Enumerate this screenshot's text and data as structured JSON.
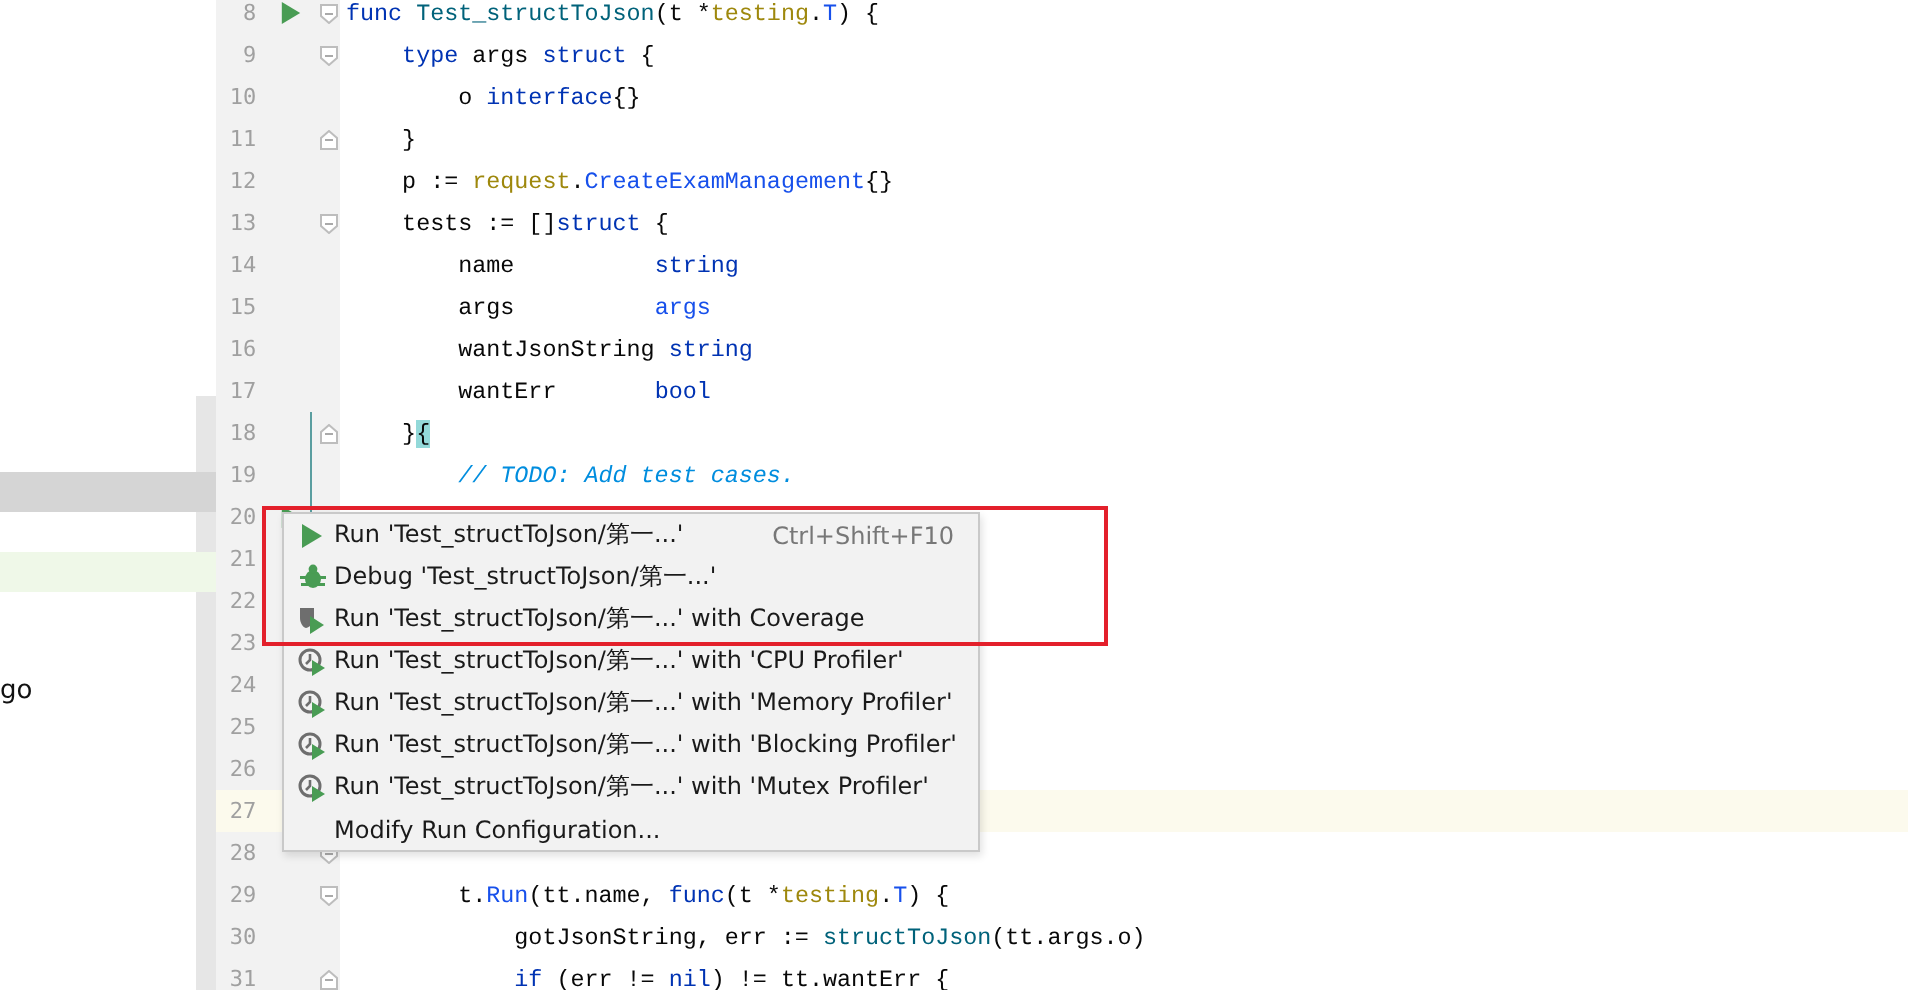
{
  "side_panel": {
    "rows": [
      {
        "selected": true,
        "changed": false
      },
      {
        "selected": false,
        "changed": true
      }
    ],
    "text": "go"
  },
  "editor": {
    "lines": [
      {
        "number": "8",
        "run": true,
        "fold_start": true,
        "tokens": [
          {
            "kind": "kw",
            "text": "func "
          },
          {
            "kind": "fn",
            "text": "Test_structToJson"
          },
          {
            "kind": "plain",
            "text": "(t *"
          },
          {
            "kind": "pkg",
            "text": "testing"
          },
          {
            "kind": "plain",
            "text": "."
          },
          {
            "kind": "type",
            "text": "T"
          },
          {
            "kind": "plain",
            "text": ") {"
          }
        ]
      },
      {
        "number": "9",
        "fold_start": true,
        "tokens": [
          {
            "kind": "kw",
            "text": "    type "
          },
          {
            "kind": "plain",
            "text": "args "
          },
          {
            "kind": "kw",
            "text": "struct"
          },
          {
            "kind": "plain",
            "text": " {"
          }
        ]
      },
      {
        "number": "10",
        "tokens": [
          {
            "kind": "plain",
            "text": "        o "
          },
          {
            "kind": "kw",
            "text": "interface"
          },
          {
            "kind": "plain",
            "text": "{}"
          }
        ]
      },
      {
        "number": "11",
        "fold_end": true,
        "tokens": [
          {
            "kind": "plain",
            "text": "    }"
          }
        ]
      },
      {
        "number": "12",
        "tokens": [
          {
            "kind": "plain",
            "text": "    p := "
          },
          {
            "kind": "pkg",
            "text": "request"
          },
          {
            "kind": "plain",
            "text": "."
          },
          {
            "kind": "type",
            "text": "CreateExamManagement"
          },
          {
            "kind": "plain",
            "text": "{}"
          }
        ]
      },
      {
        "number": "13",
        "fold_start": true,
        "tokens": [
          {
            "kind": "plain",
            "text": "    tests := []"
          },
          {
            "kind": "kw",
            "text": "struct"
          },
          {
            "kind": "plain",
            "text": " {"
          }
        ]
      },
      {
        "number": "14",
        "tokens": [
          {
            "kind": "plain",
            "text": "        name          "
          },
          {
            "kind": "kw",
            "text": "string"
          }
        ]
      },
      {
        "number": "15",
        "tokens": [
          {
            "kind": "plain",
            "text": "        args          "
          },
          {
            "kind": "type",
            "text": "args"
          }
        ]
      },
      {
        "number": "16",
        "tokens": [
          {
            "kind": "plain",
            "text": "        wantJsonString "
          },
          {
            "kind": "kw",
            "text": "string"
          }
        ]
      },
      {
        "number": "17",
        "tokens": [
          {
            "kind": "plain",
            "text": "        wantErr       "
          },
          {
            "kind": "kw",
            "text": "bool"
          }
        ]
      },
      {
        "number": "18",
        "fold_end": true,
        "changed": true,
        "tokens": [
          {
            "kind": "plain",
            "text": "    }"
          },
          {
            "kind": "match",
            "text": "{"
          }
        ]
      },
      {
        "number": "19",
        "changed": true,
        "tokens": [
          {
            "kind": "comment",
            "text": "        // TODO: Add test cases."
          }
        ]
      },
      {
        "number": "20",
        "run": true,
        "changed": true
      },
      {
        "number": "21"
      },
      {
        "number": "22"
      },
      {
        "number": "23"
      },
      {
        "number": "24"
      },
      {
        "number": "25"
      },
      {
        "number": "26"
      },
      {
        "number": "27",
        "current": true
      },
      {
        "number": "28",
        "fold_start": true
      },
      {
        "number": "29",
        "fold_start": true,
        "tokens": [
          {
            "kind": "plain",
            "text": "        t."
          },
          {
            "kind": "type",
            "text": "Run"
          },
          {
            "kind": "plain",
            "text": "(tt.name, "
          },
          {
            "kind": "kw",
            "text": "func"
          },
          {
            "kind": "plain",
            "text": "(t *"
          },
          {
            "kind": "pkg",
            "text": "testing"
          },
          {
            "kind": "plain",
            "text": "."
          },
          {
            "kind": "type",
            "text": "T"
          },
          {
            "kind": "plain",
            "text": ") {"
          }
        ]
      },
      {
        "number": "30",
        "tokens": [
          {
            "kind": "plain",
            "text": "            gotJsonString, err := "
          },
          {
            "kind": "fn",
            "text": "structToJson"
          },
          {
            "kind": "plain",
            "text": "(tt.args.o)"
          }
        ]
      },
      {
        "number": "31",
        "fold_end": true,
        "tokens": [
          {
            "kind": "kw",
            "text": "            if"
          },
          {
            "kind": "plain",
            "text": " (err != "
          },
          {
            "kind": "kw",
            "text": "nil"
          },
          {
            "kind": "plain",
            "text": ") != tt.wantErr {"
          }
        ]
      }
    ]
  },
  "context_menu": {
    "items": [
      {
        "kind": "run",
        "label": "Run 'Test_structToJson/第一...'",
        "shortcut": "Ctrl+Shift+F10"
      },
      {
        "kind": "debug",
        "label": "Debug 'Test_structToJson/第一...'"
      },
      {
        "kind": "coverage",
        "label": "Run 'Test_structToJson/第一...' with Coverage"
      },
      {
        "kind": "profiler",
        "label": "Run 'Test_structToJson/第一...' with 'CPU Profiler'"
      },
      {
        "kind": "profiler",
        "label": "Run 'Test_structToJson/第一...' with 'Memory Profiler'"
      },
      {
        "kind": "profiler",
        "label": "Run 'Test_structToJson/第一...' with 'Blocking Profiler'"
      },
      {
        "kind": "profiler",
        "label": "Run 'Test_structToJson/第一...' with 'Mutex Profiler'"
      },
      {
        "kind": "plain",
        "label": "Modify Run Configuration..."
      }
    ]
  },
  "annotation": {
    "kind": "highlight-box"
  }
}
